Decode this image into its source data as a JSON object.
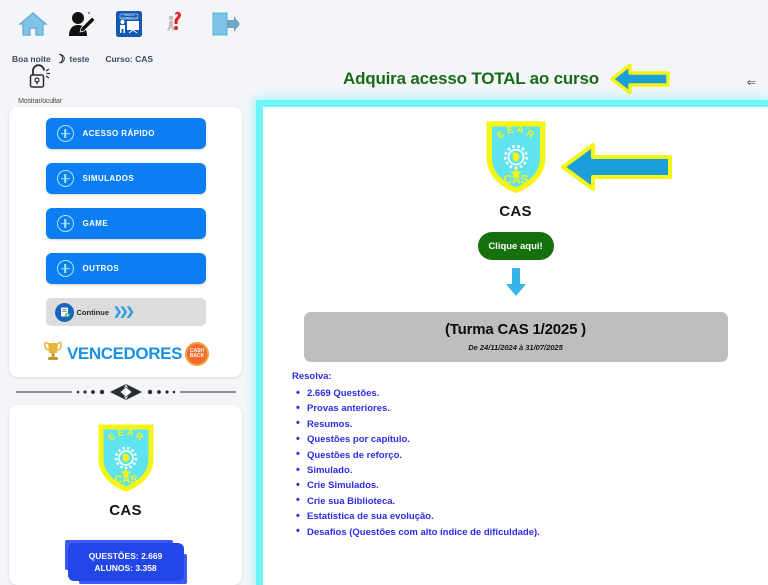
{
  "topbar": {
    "icons": [
      {
        "name": "home-icon",
        "label": "Início"
      },
      {
        "name": "user-edit-icon",
        "label": "Editar perfil"
      },
      {
        "name": "courses-training-icon",
        "label": "Cursos e Treinamentos"
      },
      {
        "name": "help-question-icon",
        "label": "Ajuda"
      },
      {
        "name": "logout-icon",
        "label": "Sair"
      }
    ]
  },
  "greeting": {
    "salutation": "Boa noite",
    "moon_glyph": "☽",
    "username": "teste",
    "course_label": "Curso: CAS"
  },
  "lock_toggle": {
    "icon": "open-padlock-icon",
    "label": "Mostrar/ocultar"
  },
  "sidebar": {
    "menu_items": [
      {
        "label": "ACESSO RÁPIDO"
      },
      {
        "label": "SIMULADOS"
      },
      {
        "label": "GAME"
      },
      {
        "label": "OUTROS"
      }
    ],
    "continue": {
      "label": "Continue",
      "chevrons": "❯❯❯"
    },
    "vencedores": {
      "label": "VENCEDORES",
      "trophy_icon": "trophy-icon",
      "cashback_line1": "CASH",
      "cashback_line2": "BACK"
    },
    "ornament": "••••✦✧✦••••"
  },
  "course_card": {
    "shield": {
      "top_text": "EEAR",
      "bottom_text": "CAS",
      "fill_color": "#5fe3ee",
      "border_color": "#f5f513"
    },
    "name": "CAS",
    "stats": {
      "questions": "QUESTÕES: 2.669",
      "students": "ALUNOS: 3.358"
    }
  },
  "promo": {
    "headline": "Adquira acesso TOTAL ao curso",
    "headline_color": "#176b18",
    "arrow_fill": "#1b9ed9",
    "arrow_stroke": "#f5f513",
    "collapse_glyph": "⇐"
  },
  "main": {
    "shield": {
      "top_text": "EEAR",
      "bottom_text": "CAS"
    },
    "course_label": "CAS",
    "cta_button": "Clique aqui!",
    "cta_color": "#15700e",
    "down_arrow_color": "#36b6e8",
    "turma": {
      "title": "(Turma CAS 1/2025 )",
      "period": "De 24/11/2024 à 31/07/2025"
    },
    "resolva_label": "Resolva:",
    "features": [
      "2.669 Questões.",
      "Provas anteriores.",
      "Resumos.",
      "Questões por capítulo.",
      "Questões de reforço.",
      "Simulado.",
      "Crie Simulados.",
      "Crie sua Biblioteca.",
      "Estatística de sua evolução.",
      "Desafios (Questões com alto índice de dificuldade)."
    ],
    "text_color": "#2b2be8"
  }
}
